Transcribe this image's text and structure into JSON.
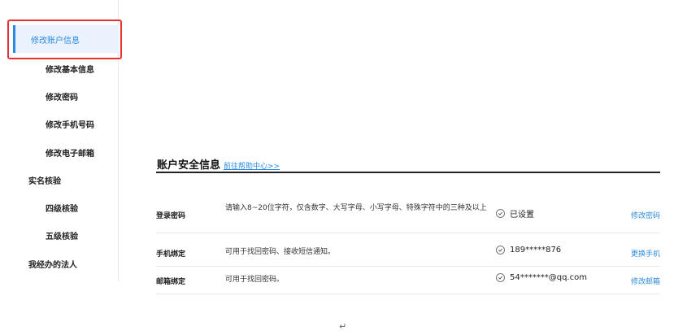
{
  "sidebar": {
    "active": "修改账户信息",
    "items": [
      {
        "label": "修改基本信息"
      },
      {
        "label": "修改密码"
      },
      {
        "label": "修改手机号码"
      },
      {
        "label": "修改电子邮箱"
      }
    ],
    "group_realname": "实名核验",
    "realname_items": [
      {
        "label": "四级核验"
      },
      {
        "label": "五级核验"
      }
    ],
    "group_legal": "我经办的法人"
  },
  "main": {
    "title": "账户安全信息",
    "help_link": "前往帮助中心>>",
    "rows": [
      {
        "label": "登录密码",
        "desc": "请输入8~20位字符，仅含数字、大写字母、小写字母、特殊字符中的三种及以上",
        "status": "已设置",
        "action": "修改密码"
      },
      {
        "label": "手机绑定",
        "desc": "可用于找回密码、接收短信通知。",
        "status": "189*****876",
        "action": "更换手机"
      },
      {
        "label": "邮箱绑定",
        "desc": "可用于找回密码。",
        "status": "54*******@qq.com",
        "action": "修改邮箱"
      }
    ]
  },
  "colors": {
    "accent": "#2b8ae0",
    "highlight": "#e8312f",
    "active_bg": "#eaf2fd"
  },
  "footer_mark": "↵"
}
